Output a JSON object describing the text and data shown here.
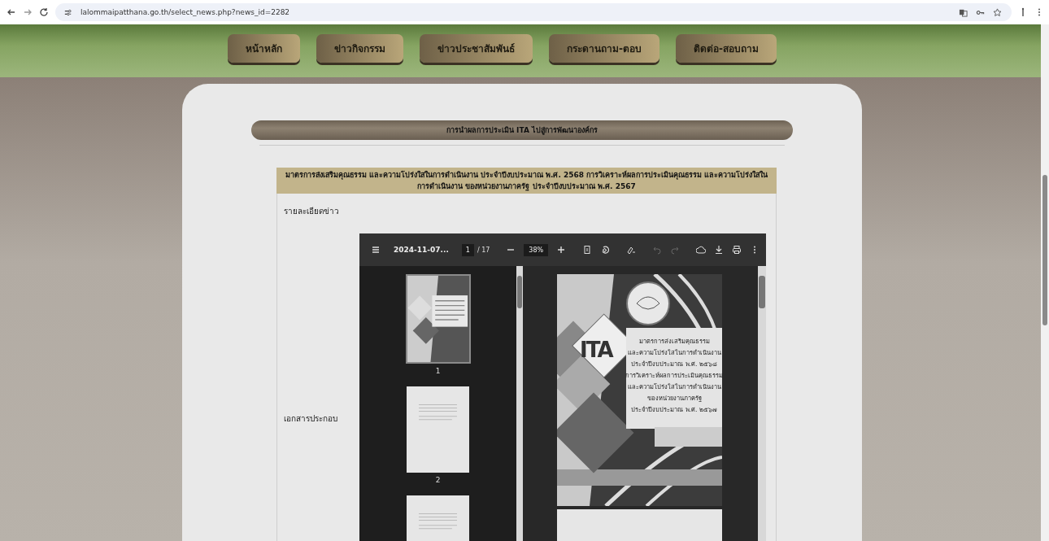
{
  "browser": {
    "url": "lalommaipatthana.go.th/select_news.php?news_id=2282"
  },
  "nav": [
    {
      "label": "หน้าหลัก"
    },
    {
      "label": "ข่าวกิจกรรม"
    },
    {
      "label": "ข่าวประชาสัมพันธ์"
    },
    {
      "label": "กระดานถาม-ตอบ"
    },
    {
      "label": "ติดต่อ-สอบถาม"
    }
  ],
  "page_title": "การนำผลการประเมิน ITA ไปสู่การพัฒนาองค์กร",
  "news": {
    "headline": "มาตรการส่งเสริมคุณธรรม และความโปร่งใสในการดำเนินงาน ประจำปีงบประมาณ พ.ศ. 2568 การวิเคราะห์ผลการประเมินคุณธรรม และความโปร่งใสในการดำเนินงาน ของหน่วยงานภาครัฐ ประจำปีงบประมาณ พ.ศ. 2567",
    "details_label": "รายละเอียดข่าว",
    "attachment_label": "เอกสารประกอบ"
  },
  "pdf_viewer": {
    "file_name": "2024-11-07...",
    "page": "1",
    "page_total": "/ 17",
    "zoom": "38%",
    "thumbnails": [
      {
        "label": "1",
        "selected": true
      },
      {
        "label": "2",
        "selected": false
      },
      {
        "selected": false
      }
    ],
    "cover": {
      "logo": "ITA",
      "lines": [
        "มาตรการส่งเสริมคุณธรรม",
        "และความโปร่งใสในการดำเนินงาน",
        "ประจำปีงบประมาณ พ.ศ. ๒๕๖๘",
        "การวิเคราะห์ผลการประเมินคุณธรรม",
        "และความโปร่งใสในการดำเนินงาน",
        "ของหน่วยงานภาครัฐ",
        "ประจำปีงบประมาณ พ.ศ. ๒๕๖๗"
      ]
    }
  }
}
